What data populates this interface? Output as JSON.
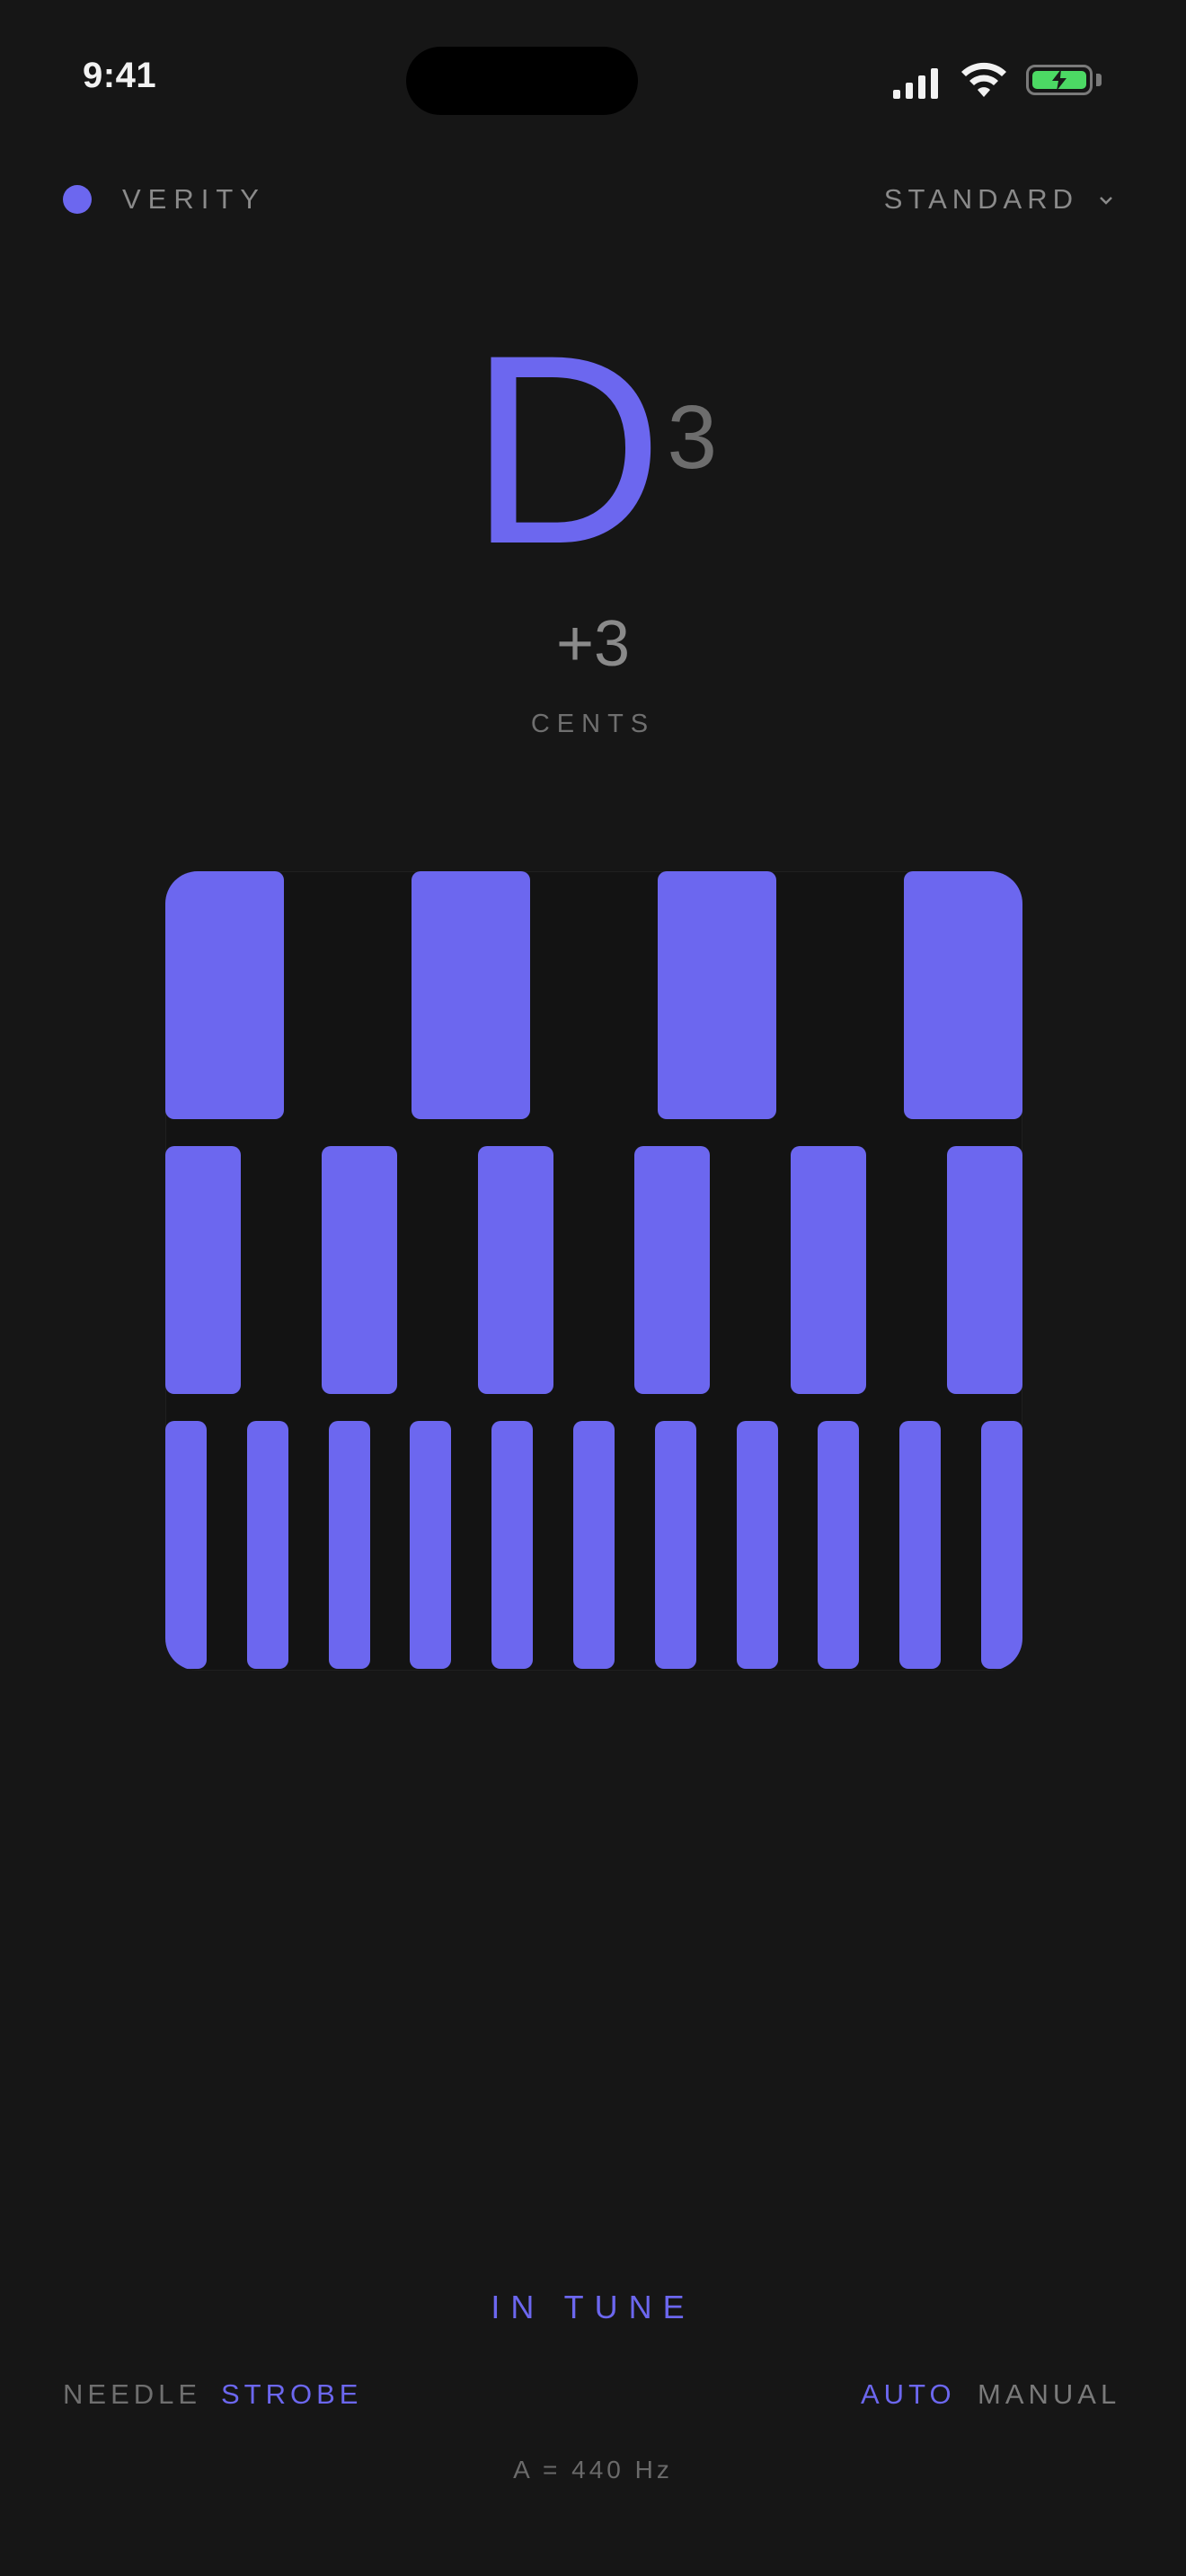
{
  "status": {
    "time": "9:41"
  },
  "header": {
    "brand": "VERITY",
    "tuning": "STANDARD"
  },
  "note": {
    "letter": "D",
    "octave": "3",
    "cents": "+3",
    "cents_label": "CENTS"
  },
  "strobe": {
    "color": "#6c67ef",
    "bands": [
      {
        "bars": 4
      },
      {
        "bars": 6
      },
      {
        "bars": 11
      }
    ]
  },
  "footer": {
    "status": "IN TUNE",
    "display_modes": [
      {
        "label": "NEEDLE",
        "active": false
      },
      {
        "label": "STROBE",
        "active": true
      }
    ],
    "detect_modes": [
      {
        "label": "AUTO",
        "active": true
      },
      {
        "label": "MANUAL",
        "active": false
      }
    ],
    "reference": "A = 440 Hz"
  },
  "colors": {
    "accent": "#6c67ef",
    "background": "#161616",
    "muted": "#8a8a8a"
  }
}
